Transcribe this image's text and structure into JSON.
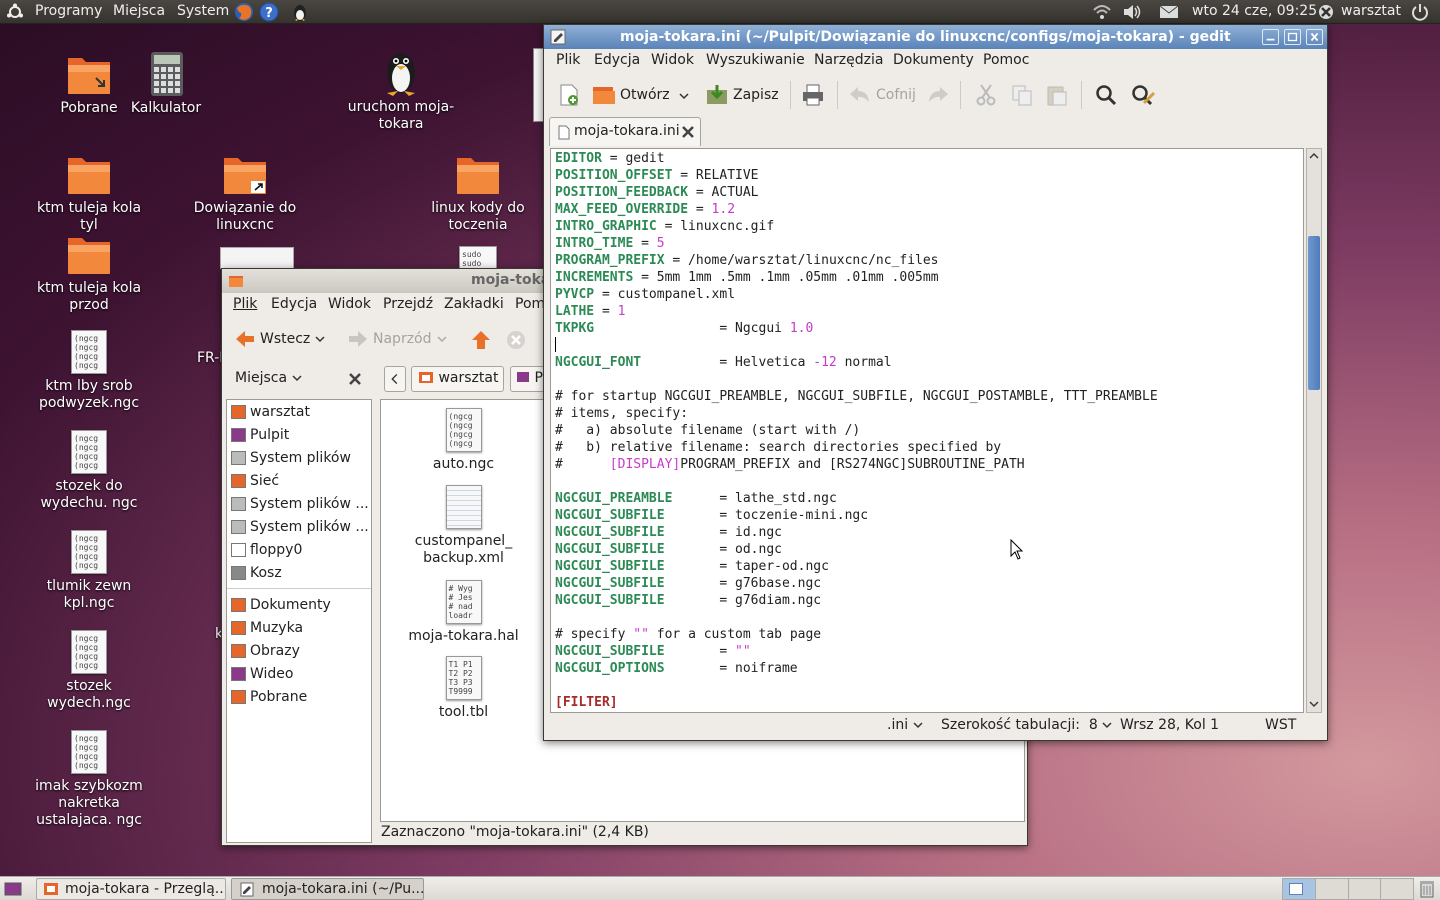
{
  "top_panel": {
    "menus": [
      "Programy",
      "Miejsca",
      "System"
    ],
    "clock": "wto 24 cze, 09:25",
    "user": "warsztat"
  },
  "desktop": {
    "icons": [
      {
        "label": "Pobrane",
        "kind": "folder"
      },
      {
        "label": "Kalkulator",
        "kind": "calculator"
      },
      {
        "label": "uruchom moja-tokara",
        "kind": "penguin"
      },
      {
        "label": "ktm tuleja kola tyl",
        "kind": "folder"
      },
      {
        "label": "Dowiązanie do linuxcnc",
        "kind": "folder-link"
      },
      {
        "label": "linux kody do toczenia",
        "kind": "folder"
      },
      {
        "label": "ktm tuleja kola przod",
        "kind": "folder"
      },
      {
        "label": "ktm lby srob podwyzek.ngc",
        "kind": "ngc"
      },
      {
        "label": "stozek do wydechu. ngc",
        "kind": "ngc"
      },
      {
        "label": "tlumik zewn kpl.ngc",
        "kind": "ngc"
      },
      {
        "label": "stozek wydech.ngc",
        "kind": "ngc"
      },
      {
        "label": "imak szybkozm nakretka ustalajaca. ngc",
        "kind": "ngc"
      }
    ],
    "ngc_thumb": "(ngcg\n(ngcg\n(ngcg\n(ngcg",
    "partial_fr": "FR-I",
    "partial_k": "k",
    "sudo_thumb": "sudo\nsudo"
  },
  "gedit": {
    "title": "moja-tokara.ini (~/Pulpit/Dowiązanie do linuxcnc/configs/moja-tokara) - gedit",
    "menu": [
      "Plik",
      "Edycja",
      "Widok",
      "Wyszukiwanie",
      "Narzędzia",
      "Dokumenty",
      "Pomoc"
    ],
    "toolbar": {
      "open": "Otwórz",
      "save": "Zapisz",
      "undo": "Cofnij"
    },
    "tab": "moja-tokara.ini",
    "status": {
      "lang": ".ini",
      "tab_width": "Szerokość tabulacji:  8",
      "position": "Wrsz 28, Kol 1",
      "mode": "WST"
    }
  },
  "code_lines": [
    [
      [
        "k",
        "EDITOR"
      ],
      [
        "t",
        " = gedit"
      ]
    ],
    [
      [
        "k",
        "POSITION_OFFSET"
      ],
      [
        "t",
        " = RELATIVE"
      ]
    ],
    [
      [
        "k",
        "POSITION_FEEDBACK"
      ],
      [
        "t",
        " = ACTUAL"
      ]
    ],
    [
      [
        "k",
        "MAX_FEED_OVERRIDE"
      ],
      [
        "t",
        " = "
      ],
      [
        "n",
        "1.2"
      ]
    ],
    [
      [
        "k",
        "INTRO_GRAPHIC"
      ],
      [
        "t",
        " = linuxcnc.gif"
      ]
    ],
    [
      [
        "k",
        "INTRO_TIME"
      ],
      [
        "t",
        " = "
      ],
      [
        "n",
        "5"
      ]
    ],
    [
      [
        "k",
        "PROGRAM_PREFIX"
      ],
      [
        "t",
        " = /home/warsztat/linuxcnc/nc_files"
      ]
    ],
    [
      [
        "k",
        "INCREMENTS"
      ],
      [
        "t",
        " = 5mm 1mm .5mm .1mm .05mm .01mm .005mm"
      ]
    ],
    [
      [
        "k",
        "PYVCP"
      ],
      [
        "t",
        " = custompanel.xml"
      ]
    ],
    [
      [
        "k",
        "LATHE"
      ],
      [
        "t",
        " = "
      ],
      [
        "n",
        "1"
      ]
    ],
    [
      [
        "k",
        "TKPKG"
      ],
      [
        "t",
        "                = Ngcgui "
      ],
      [
        "n",
        "1.0"
      ]
    ],
    [
      [
        "t",
        ""
      ]
    ],
    [
      [
        "k",
        "NGCGUI_FONT"
      ],
      [
        "t",
        "          = Helvetica "
      ],
      [
        "n",
        "-12"
      ],
      [
        "t",
        " normal"
      ]
    ],
    [
      [
        "t",
        ""
      ]
    ],
    [
      [
        "c",
        "# for startup NGCGUI_PREAMBLE, NGCGUI_SUBFILE, NGCGUI_POSTAMBLE, TTT_PREAMBLE"
      ]
    ],
    [
      [
        "c",
        "# items, specify:"
      ]
    ],
    [
      [
        "c",
        "#   a) absolute filename (start with /)"
      ]
    ],
    [
      [
        "c",
        "#   b) relative filename: search directories specified by"
      ]
    ],
    [
      [
        "c",
        "#      "
      ],
      [
        "n",
        "[DISPLAY]"
      ],
      [
        "c",
        "PROGRAM_PREFIX and [RS274NGC]SUBROUTINE_PATH"
      ]
    ],
    [
      [
        "t",
        ""
      ]
    ],
    [
      [
        "k",
        "NGCGUI_PREAMBLE"
      ],
      [
        "t",
        "      = lathe_std.ngc"
      ]
    ],
    [
      [
        "k",
        "NGCGUI_SUBFILE"
      ],
      [
        "t",
        "       = toczenie-mini.ngc"
      ]
    ],
    [
      [
        "k",
        "NGCGUI_SUBFILE"
      ],
      [
        "t",
        "       = id.ngc"
      ]
    ],
    [
      [
        "k",
        "NGCGUI_SUBFILE"
      ],
      [
        "t",
        "       = od.ngc"
      ]
    ],
    [
      [
        "k",
        "NGCGUI_SUBFILE"
      ],
      [
        "t",
        "       = taper-od.ngc"
      ]
    ],
    [
      [
        "k",
        "NGCGUI_SUBFILE"
      ],
      [
        "t",
        "       = g76base.ngc"
      ]
    ],
    [
      [
        "k",
        "NGCGUI_SUBFILE"
      ],
      [
        "t",
        "       = g76diam.ngc"
      ]
    ],
    [
      [
        "t",
        ""
      ]
    ],
    [
      [
        "c",
        "# specify "
      ],
      [
        "n",
        "\"\""
      ],
      [
        "c",
        " for a custom tab page"
      ]
    ],
    [
      [
        "k",
        "NGCGUI_SUBFILE"
      ],
      [
        "t",
        "       = "
      ],
      [
        "n",
        "\"\""
      ]
    ],
    [
      [
        "k",
        "NGCGUI_OPTIONS"
      ],
      [
        "t",
        "       = noiframe"
      ]
    ],
    [
      [
        "t",
        ""
      ]
    ],
    [
      [
        "s",
        "[FILTER]"
      ]
    ]
  ],
  "nautilus": {
    "title": "moja-toka",
    "menu": [
      "Plik",
      "Edycja",
      "Widok",
      "Przejdź",
      "Zakładki",
      "Pom"
    ],
    "back": "Wstecz",
    "forward": "Naprzód",
    "places_label": "Miejsca",
    "path_btn": "warsztat",
    "path_btn2": "P",
    "sidebar1": [
      "warsztat",
      "Pulpit",
      "System plików",
      "Sieć",
      "System plików ...",
      "System plików ...",
      "floppy0",
      "Kosz"
    ],
    "sidebar2": [
      "Dokumenty",
      "Muzyka",
      "Obrazy",
      "Wideo",
      "Pobrane"
    ],
    "files": [
      {
        "name": "auto.ngc",
        "thumb": "(ngcg\n(ngcg\n(ngcg\n(ngcg"
      },
      {
        "name": "custompanel_\nbackup.xml",
        "thumb": ""
      },
      {
        "name": "moja-tokara.hal",
        "thumb": "# Wyg\n# Jes\n# nad\nloadr"
      },
      {
        "name": "tool.tbl",
        "thumb": "T1 P1\nT2 P2\nT3 P3\nT9999"
      }
    ],
    "status": "Zaznaczono \"moja-tokara.ini\" (2,4 KB)"
  },
  "taskbar": {
    "items": [
      "moja-tokara - Przeglą...",
      "moja-tokara.ini (~/Pu..."
    ]
  }
}
